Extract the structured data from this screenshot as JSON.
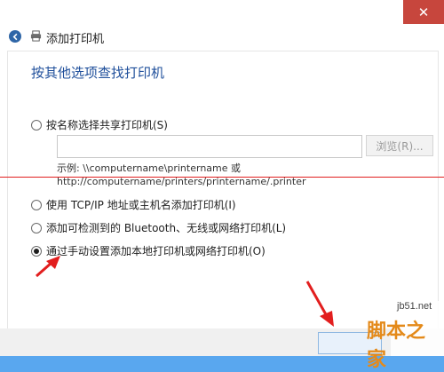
{
  "window": {
    "close_glyph": "✕",
    "header_title": "添加打印机"
  },
  "main": {
    "heading": "按其他选项查找打印机",
    "options": [
      {
        "label": "按名称选择共享打印机(S)",
        "checked": false
      },
      {
        "label": "使用 TCP/IP 地址或主机名添加打印机(I)",
        "checked": false
      },
      {
        "label": "添加可检测到的 Bluetooth、无线或网络打印机(L)",
        "checked": false
      },
      {
        "label": "通过手动设置添加本地打印机或网络打印机(O)",
        "checked": true
      }
    ],
    "share_input_value": "",
    "browse_button": "浏览(R)...",
    "example_line1": "示例: \\\\computername\\printername 或",
    "example_line2": "http://computername/printers/printername/.printer"
  },
  "watermark": {
    "url": "jb51.net",
    "name": "脚本之家"
  },
  "colors": {
    "accent_blue": "#1f4f9b",
    "close_red": "#c7463d",
    "annotation_red": "#e21e1e"
  }
}
